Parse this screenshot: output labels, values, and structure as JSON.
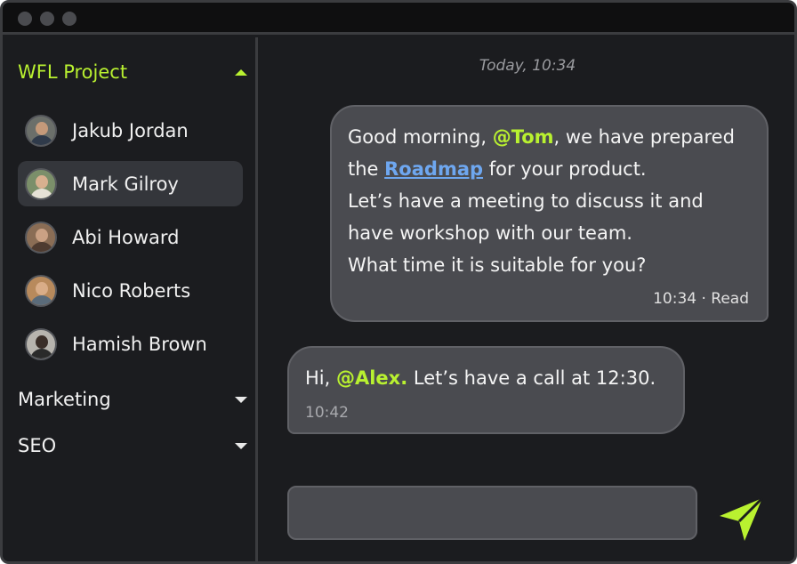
{
  "sidebar": {
    "groups": [
      {
        "label": "WFL Project",
        "expanded": true,
        "contacts": [
          {
            "name": "Jakub Jordan"
          },
          {
            "name": "Mark Gilroy",
            "selected": true
          },
          {
            "name": "Abi Howard"
          },
          {
            "name": "Nico Roberts"
          },
          {
            "name": "Hamish Brown"
          }
        ]
      },
      {
        "label": "Marketing",
        "expanded": false
      },
      {
        "label": "SEO",
        "expanded": false
      }
    ]
  },
  "chat": {
    "date_label": "Today, 10:34",
    "messages": [
      {
        "direction": "out",
        "line1_a": "Good morning, ",
        "line1_mention": "@Tom",
        "line1_b": ", we have prepared",
        "line2_a": "the ",
        "line2_link": "Roadmap",
        "line2_b": " for your product.",
        "line3": "Let’s have a meeting to discuss it and",
        "line4": "have workshop with our team.",
        "line5": "What time it is suitable for you?",
        "meta": "10:34 · Read"
      },
      {
        "direction": "in",
        "line1_a": "Hi, ",
        "line1_mention": "@Alex.",
        "line1_b": " Let’s have a call at 12:30.",
        "meta": "10:42"
      }
    ],
    "composer": {
      "value": "",
      "placeholder": ""
    }
  },
  "colors": {
    "accent": "#b9f130",
    "link": "#6ea7f0",
    "bubble": "#4a4b50",
    "background": "#1b1c1f"
  },
  "icons": {
    "send": "send-icon",
    "collapse": "caret-up-icon",
    "expand": "caret-down-icon"
  }
}
